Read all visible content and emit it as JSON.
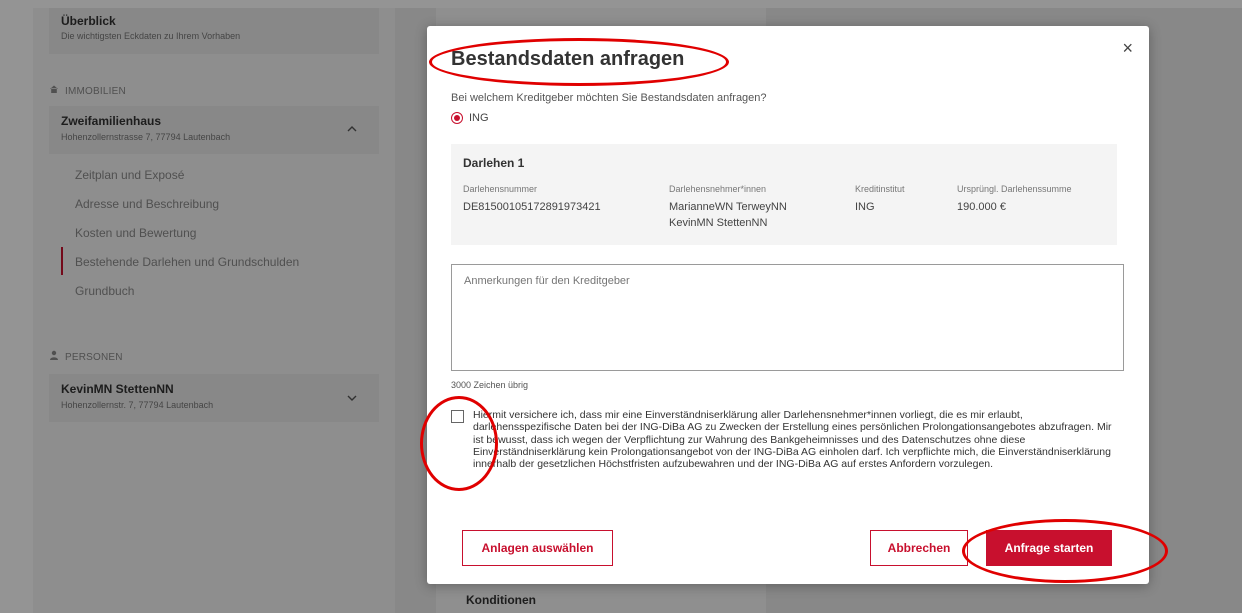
{
  "sidebar": {
    "overview": {
      "title": "Überblick",
      "subtitle": "Die wichtigsten Eckdaten zu Ihrem Vorhaben"
    },
    "immobilien_header": "IMMOBILIEN",
    "property": {
      "title": "Zweifamilienhaus",
      "address": "Hohenzollernstrasse 7, 77794 Lautenbach"
    },
    "nav": [
      {
        "label": "Zeitplan und Exposé"
      },
      {
        "label": "Adresse und Beschreibung"
      },
      {
        "label": "Kosten und Bewertung"
      },
      {
        "label": "Bestehende Darlehen und Grundschulden"
      },
      {
        "label": "Grundbuch"
      }
    ],
    "personen_header": "PERSONEN",
    "person": {
      "name": "KevinMN StettenNN",
      "address": "Hohenzollernstr. 7, 77794 Lautenbach"
    }
  },
  "content": {
    "konditionen_label": "Konditionen"
  },
  "modal": {
    "title": "Bestandsdaten anfragen",
    "close_symbol": "×",
    "question": "Bei welchem Kreditgeber möchten Sie Bestandsdaten anfragen?",
    "lender_option": "ING",
    "loan": {
      "title": "Darlehen 1",
      "columns": [
        {
          "header": "Darlehensnummer",
          "value": "DE81500105172891973421"
        },
        {
          "header": "Darlehensnehmer*innen",
          "value": "MarianneWN TerweyNN",
          "value2": "KevinMN StettenNN"
        },
        {
          "header": "Kreditinstitut",
          "value": "ING"
        },
        {
          "header": "Ursprüngl. Darlehenssumme",
          "value": "190.000 €"
        }
      ]
    },
    "remarks_placeholder": "Anmerkungen für den Kreditgeber",
    "char_counter": "3000 Zeichen übrig",
    "consent_text": "Hiermit versichere ich, dass mir eine Einverständniserklärung aller Darlehensnehmer*innen vorliegt, die es mir erlaubt, darlehensspezifische Daten bei der ING-DiBa AG zu Zwecken der Erstellung eines persönlichen Prolongationsangebotes abzufragen. Mir ist bewusst, dass ich wegen der Verpflichtung zur Wahrung des Bankgeheimnisses und des Datenschutzes ohne diese Einverständniserklärung kein Prolongationsangebot von der ING-DiBa AG einholen darf. Ich verpflichte mich, die Einverständniserklärung innerhalb der gesetzlichen Höchstfristen aufzubewahren und der ING-DiBa AG auf erstes Anfordern vorzulegen.",
    "consent_checked": false,
    "buttons": {
      "attachments": "Anlagen auswählen",
      "cancel": "Abbrechen",
      "submit": "Anfrage starten"
    }
  },
  "colors": {
    "brand": "#c8102e",
    "annotation": "#e00000"
  },
  "icons": {
    "immobilien": "home-icon",
    "personen": "person-icon",
    "collapse": "chevron-up-icon",
    "expand": "chevron-down-icon"
  }
}
